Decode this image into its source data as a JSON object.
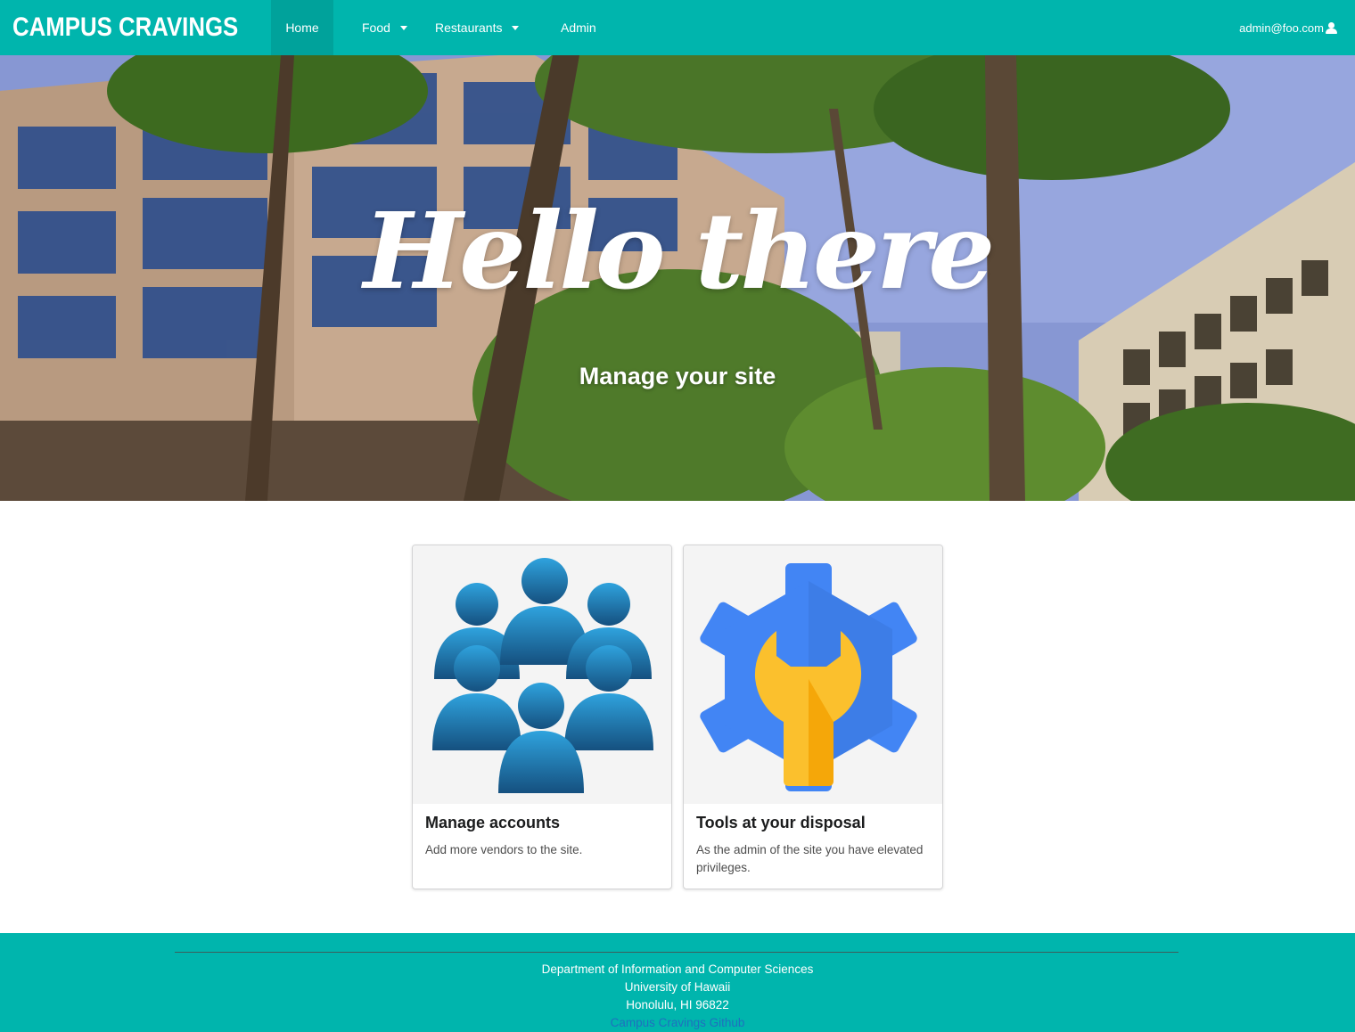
{
  "navbar": {
    "brand": "CAMPUS CRAVINGS",
    "home": "Home",
    "food": "Food",
    "restaurants": "Restaurants",
    "admin": "Admin",
    "user": "admin@foo.com"
  },
  "hero": {
    "title": "Hello there",
    "subtitle": "Manage your site"
  },
  "cards": [
    {
      "header": "Manage accounts",
      "description": "Add more vendors to the site."
    },
    {
      "header": "Tools at your disposal",
      "description": "As the admin of the site you have elevated privileges."
    }
  ],
  "footer": {
    "line1": "Department of Information and Computer Sciences",
    "line2": "University of Hawaii",
    "line3": "Honolulu, HI 96822",
    "link": "Campus Cravings Github"
  },
  "colors": {
    "brand_teal": "#00b5ad",
    "link_blue": "#1e70bf"
  }
}
